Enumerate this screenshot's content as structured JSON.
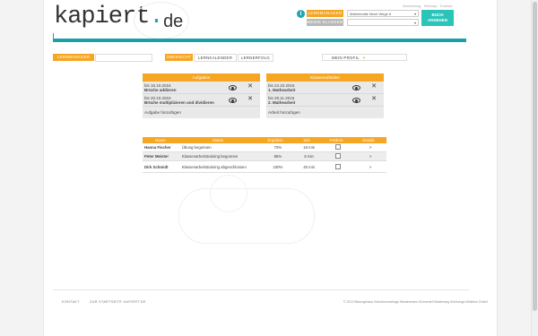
{
  "header": {
    "logo_text": "kapiert",
    "logo_dot": ".",
    "logo_de": "de",
    "toplinks": "Abmeldung · Sitemap · Kontakt",
    "info_label": "i",
    "lernmanager_label": "LERNMANAGER",
    "klassen_label": "MEINE KLASSEN",
    "book_select": "Mathematik Neue Wege 6",
    "buch_label": "BUCH ANSEHEN"
  },
  "tabs": {
    "lernmanager": "LERNMANAGER",
    "uebersicht": "ÜBERSICHT",
    "lernkalender": "LERNKALENDER",
    "lernerfolg": "LERNERFOLG",
    "profil": "MEIN PROFIL"
  },
  "aufgaben": {
    "title": "Aufgaben",
    "items": [
      {
        "date": "bis 16.10.2016",
        "title": "Brüche addieren"
      },
      {
        "date": "bis 20.10.2016",
        "title": "Brüche multiplizieren und dividieren"
      }
    ],
    "add_label": "Aufgabe hinzufügen"
  },
  "klassenarbeiten": {
    "title": "Klassenarbeiten",
    "items": [
      {
        "date": "bis 24.10.2016",
        "title": "1. Mathearbeit"
      },
      {
        "date": "bis 28.11.2016",
        "title": "2. Mathearbeit"
      }
    ],
    "add_label": "Arbeit hinzufügen"
  },
  "table": {
    "headers": [
      "Name",
      "Status",
      "Ergebnis",
      "Zeit",
      "Fördern",
      "Details"
    ],
    "rows": [
      {
        "name": "Hanna Fischer",
        "status": "Übung begonnen",
        "result": "70%",
        "time": "16 min",
        "details": ">"
      },
      {
        "name": "Peter Meister",
        "status": "Klassenarbeitstraining begonnen",
        "result": "85%",
        "time": "8 min",
        "details": ">"
      },
      {
        "name": "Dirk Schmidt",
        "status": "Klassenarbeitstraining abgeschlossen",
        "result": "100%",
        "time": "45 min",
        "details": ">"
      }
    ]
  },
  "footer": {
    "kontakt": "KONTAKT",
    "startseite": "ZUR STARTSEITE KAPIERT.DE",
    "copyright": "© 2013 Bildungshaus Schulbuchverlage Westermann Schroedel Diesterweg Schöningh Winklers GmbH"
  },
  "colors": {
    "accent": "#f6a623",
    "teal": "#1aa0aa"
  }
}
